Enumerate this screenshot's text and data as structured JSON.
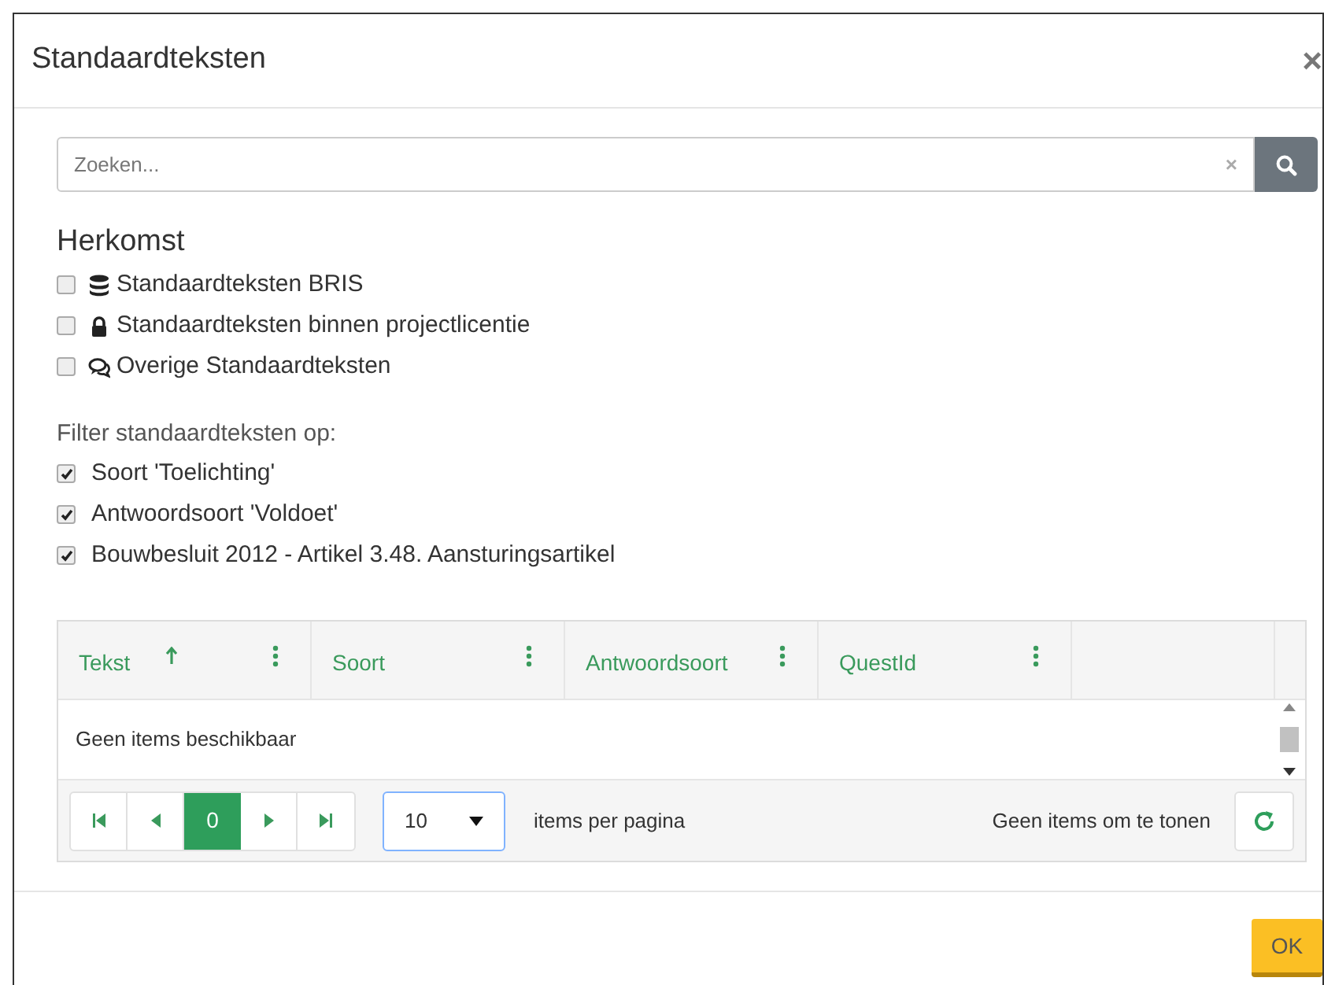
{
  "dialog": {
    "title": "Standaardteksten",
    "close": "×"
  },
  "search": {
    "placeholder": "Zoeken...",
    "clear": "×"
  },
  "origin": {
    "heading": "Herkomst",
    "options": [
      {
        "label": "Standaardteksten BRIS",
        "checked": false
      },
      {
        "label": "Standaardteksten binnen projectlicentie",
        "checked": false
      },
      {
        "label": "Overige Standaardteksten",
        "checked": false
      }
    ]
  },
  "filter": {
    "heading": "Filter standaardteksten op:",
    "options": [
      {
        "label": "Soort 'Toelichting'",
        "checked": true
      },
      {
        "label": "Antwoordsoort 'Voldoet'",
        "checked": true
      },
      {
        "label": "Bouwbesluit 2012 - Artikel 3.48. Aansturingsartikel",
        "checked": true
      }
    ]
  },
  "table": {
    "columns": [
      {
        "label": "Tekst",
        "sorted": true
      },
      {
        "label": "Soort",
        "sorted": false
      },
      {
        "label": "Antwoordsoort",
        "sorted": false
      },
      {
        "label": "QuestId",
        "sorted": false
      }
    ],
    "empty_message": "Geen items beschikbaar"
  },
  "pager": {
    "pages": [
      {
        "label": "0",
        "selected": true
      }
    ],
    "page_size": "10",
    "page_size_label": "items per pagina",
    "info": "Geen items om te tonen"
  },
  "buttons": [
    {
      "label": "OK"
    }
  ]
}
